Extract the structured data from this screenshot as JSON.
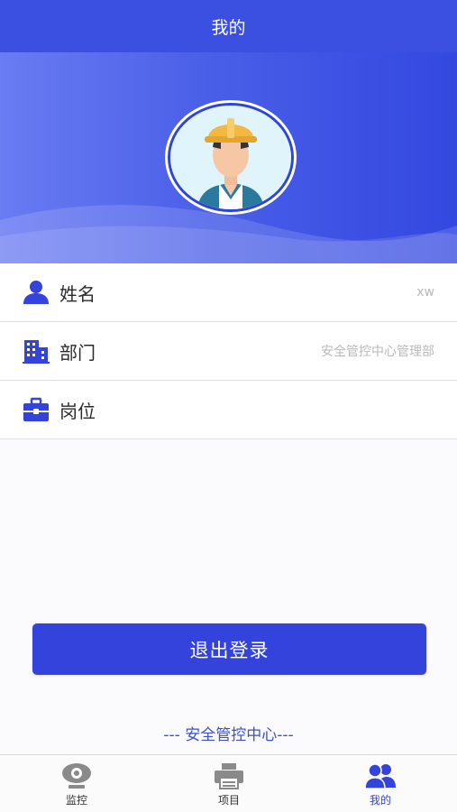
{
  "header": {
    "title": "我的"
  },
  "profile": {
    "rows": [
      {
        "label": "姓名",
        "value": "xw",
        "icon": "user-icon"
      },
      {
        "label": "部门",
        "value": "安全管控中心管理部",
        "icon": "building-icon"
      },
      {
        "label": "岗位",
        "value": "",
        "icon": "briefcase-icon"
      }
    ]
  },
  "actions": {
    "logout_label": "退出登录"
  },
  "footer": {
    "text": "--- 安全管控中心---"
  },
  "tabs": [
    {
      "label": "监控",
      "icon": "camera-icon",
      "active": false
    },
    {
      "label": "项目",
      "icon": "printer-icon",
      "active": false
    },
    {
      "label": "我的",
      "icon": "users-icon",
      "active": true
    }
  ],
  "colors": {
    "primary": "#3443db",
    "header": "#3b4fe0",
    "muted_text": "#b9b9b9"
  }
}
